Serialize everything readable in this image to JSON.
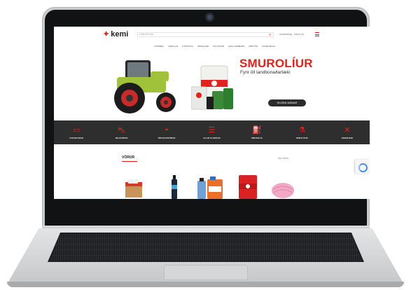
{
  "site": {
    "logo_mark": "✦",
    "logo_text": "kemi",
    "search_placeholder": "Leita að vöru",
    "account_text": "Innskráning · Karfa (0)",
    "nav": [
      "FORSÍÐA",
      "VERSLUN",
      "ÞJÓNUSTA",
      "UMSAGNIR",
      "UM OKKUR",
      "HAFA SAMBAND",
      "FRÉTTIR",
      "STARFSFÓLK"
    ]
  },
  "hero": {
    "title": "SMUROLÍUR",
    "subtitle": "Fyrir öll landbúnaðartæki",
    "button_label": "SKOÐA NÁNAR"
  },
  "categories": [
    {
      "label": "RAFGEYMAR",
      "icon": "battery-icon"
    },
    {
      "label": "BÍLAVÖRUR",
      "icon": "car-icon"
    },
    {
      "label": "ÖRYGGISVÖRUR",
      "icon": "helmet-icon"
    },
    {
      "label": "ALLIR FLOKKAR",
      "icon": "list-icon"
    },
    {
      "label": "SMUROLÍA",
      "icon": "oil-can-icon"
    },
    {
      "label": "SPRAUTUR",
      "icon": "spray-icon"
    },
    {
      "label": "VERKFÆRI",
      "icon": "tools-icon"
    }
  ],
  "products": {
    "title": "VÖRUR",
    "sort_label": "Sjá meira"
  },
  "colors": {
    "accent": "#e3231b",
    "dark_strip": "#2e2e2e",
    "tractor_green": "#9fc23a"
  }
}
